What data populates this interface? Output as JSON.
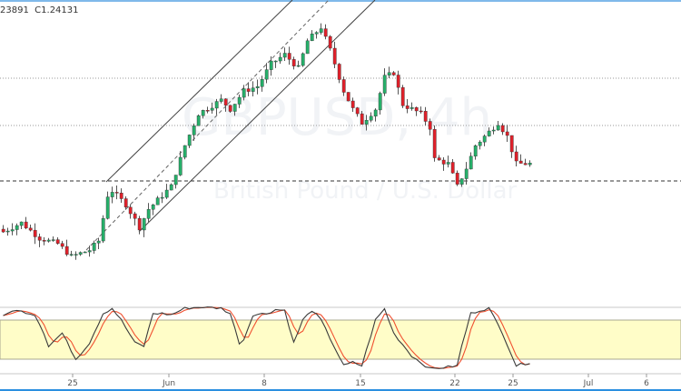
{
  "header": {
    "ohlc_text": "23891  C1.24131"
  },
  "watermark": {
    "symbol": "GBPUSD, 4h",
    "description": "British Pound / U.S. Dollar"
  },
  "colors": {
    "up": "#26b06a",
    "down": "#e0202a",
    "stoch_k": "#3a3a3a",
    "stoch_d": "#f05030",
    "band": "#fffdc8",
    "accent": "#2b8fe0"
  },
  "chart_data": [
    {
      "type": "candlestick",
      "title": "GBPUSD, 4h",
      "last_close": 1.24131,
      "close_path": [
        [
          0,
          1.2338
        ],
        [
          4,
          1.2348
        ],
        [
          8,
          1.2331
        ],
        [
          12,
          1.2325
        ],
        [
          15,
          1.2311
        ],
        [
          19,
          1.2318
        ],
        [
          21,
          1.2328
        ],
        [
          23,
          1.2378
        ],
        [
          24,
          1.2383
        ],
        [
          27,
          1.2368
        ],
        [
          30,
          1.2343
        ],
        [
          32,
          1.2363
        ],
        [
          35,
          1.2378
        ],
        [
          37,
          1.2388
        ],
        [
          40,
          1.2433
        ],
        [
          43,
          1.2468
        ],
        [
          48,
          1.2483
        ],
        [
          50,
          1.2473
        ],
        [
          53,
          1.2493
        ],
        [
          56,
          1.2498
        ],
        [
          59,
          1.2523
        ],
        [
          62,
          1.2533
        ],
        [
          65,
          1.2518
        ],
        [
          67,
          1.2548
        ],
        [
          70,
          1.2563
        ],
        [
          72,
          1.2538
        ],
        [
          75,
          1.2493
        ],
        [
          77,
          1.2473
        ],
        [
          79,
          1.2458
        ],
        [
          82,
          1.2473
        ],
        [
          84,
          1.2508
        ],
        [
          86,
          1.2513
        ],
        [
          88,
          1.2478
        ],
        [
          92,
          1.2468
        ],
        [
          94,
          1.2453
        ],
        [
          95,
          1.2418
        ],
        [
          98,
          1.2413
        ],
        [
          100,
          1.2388
        ],
        [
          102,
          1.2408
        ],
        [
          104,
          1.2433
        ],
        [
          107,
          1.2448
        ],
        [
          109,
          1.2458
        ],
        [
          111,
          1.2443
        ],
        [
          113,
          1.2413
        ],
        [
          115,
          1.2413
        ],
        [
          116,
          1.2413
        ]
      ],
      "horizontal_levels": [
        "dotted",
        "dotted",
        "dashed"
      ],
      "x_ticks": [
        "25",
        "Jun",
        "8",
        "15",
        "22",
        "25",
        "Jul",
        "6"
      ]
    },
    {
      "type": "line",
      "title": "Stochastic",
      "ylim": [
        0,
        100
      ],
      "band": [
        20,
        80
      ],
      "k_path": [
        [
          0,
          85
        ],
        [
          2,
          95
        ],
        [
          5,
          92
        ],
        [
          7,
          88
        ],
        [
          9,
          60
        ],
        [
          10,
          40
        ],
        [
          13,
          60
        ],
        [
          16,
          20
        ],
        [
          17,
          28
        ],
        [
          19,
          45
        ],
        [
          22,
          90
        ],
        [
          24,
          98
        ],
        [
          26,
          80
        ],
        [
          29,
          45
        ],
        [
          31,
          40
        ],
        [
          33,
          90
        ],
        [
          35,
          90
        ],
        [
          37,
          88
        ],
        [
          40,
          98
        ],
        [
          44,
          100
        ],
        [
          48,
          98
        ],
        [
          50,
          90
        ],
        [
          52,
          45
        ],
        [
          53,
          50
        ],
        [
          55,
          88
        ],
        [
          58,
          90
        ],
        [
          60,
          96
        ],
        [
          62,
          95
        ],
        [
          64,
          45
        ],
        [
          66,
          80
        ],
        [
          68,
          95
        ],
        [
          70,
          80
        ],
        [
          75,
          10
        ],
        [
          77,
          15
        ],
        [
          79,
          10
        ],
        [
          82,
          80
        ],
        [
          84,
          97
        ],
        [
          86,
          60
        ],
        [
          90,
          25
        ],
        [
          92,
          15
        ],
        [
          94,
          5
        ],
        [
          98,
          8
        ],
        [
          100,
          10
        ],
        [
          101,
          40
        ],
        [
          103,
          90
        ],
        [
          105,
          95
        ],
        [
          107,
          98
        ],
        [
          110,
          60
        ],
        [
          113,
          10
        ],
        [
          116,
          15
        ]
      ]
    }
  ]
}
